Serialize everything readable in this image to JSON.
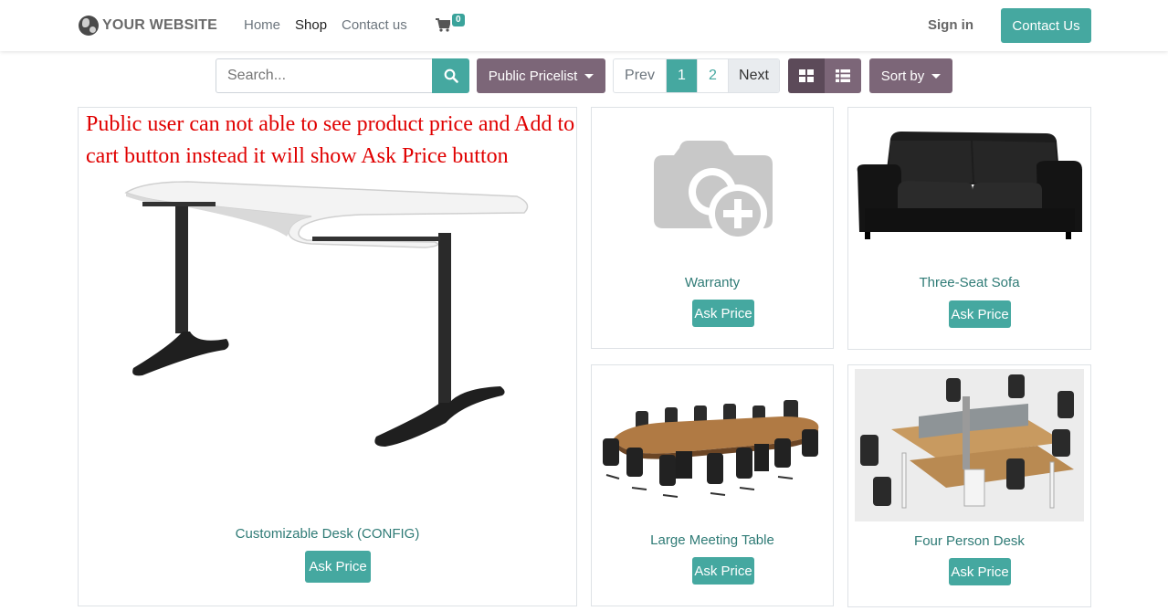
{
  "header": {
    "logo_text": "YOUR WEBSITE",
    "nav": [
      {
        "label": "Home"
      },
      {
        "label": "Shop"
      },
      {
        "label": "Contact us"
      }
    ],
    "cart_count": "0",
    "signin_label": "Sign in",
    "contact_button": "Contact Us"
  },
  "toolbar": {
    "search_placeholder": "Search...",
    "pricelist_label": "Public Pricelist",
    "pager": {
      "prev": "Prev",
      "pages": [
        "1",
        "2"
      ],
      "next": "Next",
      "current": "1"
    },
    "sort_label": "Sort by"
  },
  "annotation": "Public user can not able to see product price and Add to cart button instead it will show Ask Price button",
  "products": [
    {
      "name": "Customizable Desk (CONFIG)",
      "button": "Ask Price",
      "image": "desk"
    },
    {
      "name": "Warranty",
      "button": "Ask Price",
      "image": "camera-placeholder-icon"
    },
    {
      "name": "Three-Seat Sofa",
      "button": "Ask Price",
      "image": "sofa"
    },
    {
      "name": "Large Meeting Table",
      "button": "Ask Price",
      "image": "meeting-table"
    },
    {
      "name": "Four Person Desk",
      "button": "Ask Price",
      "image": "four-person-desk"
    }
  ],
  "colors": {
    "primary": "#45a8a0",
    "secondary": "#7c6678",
    "annotation": "#e00000"
  }
}
